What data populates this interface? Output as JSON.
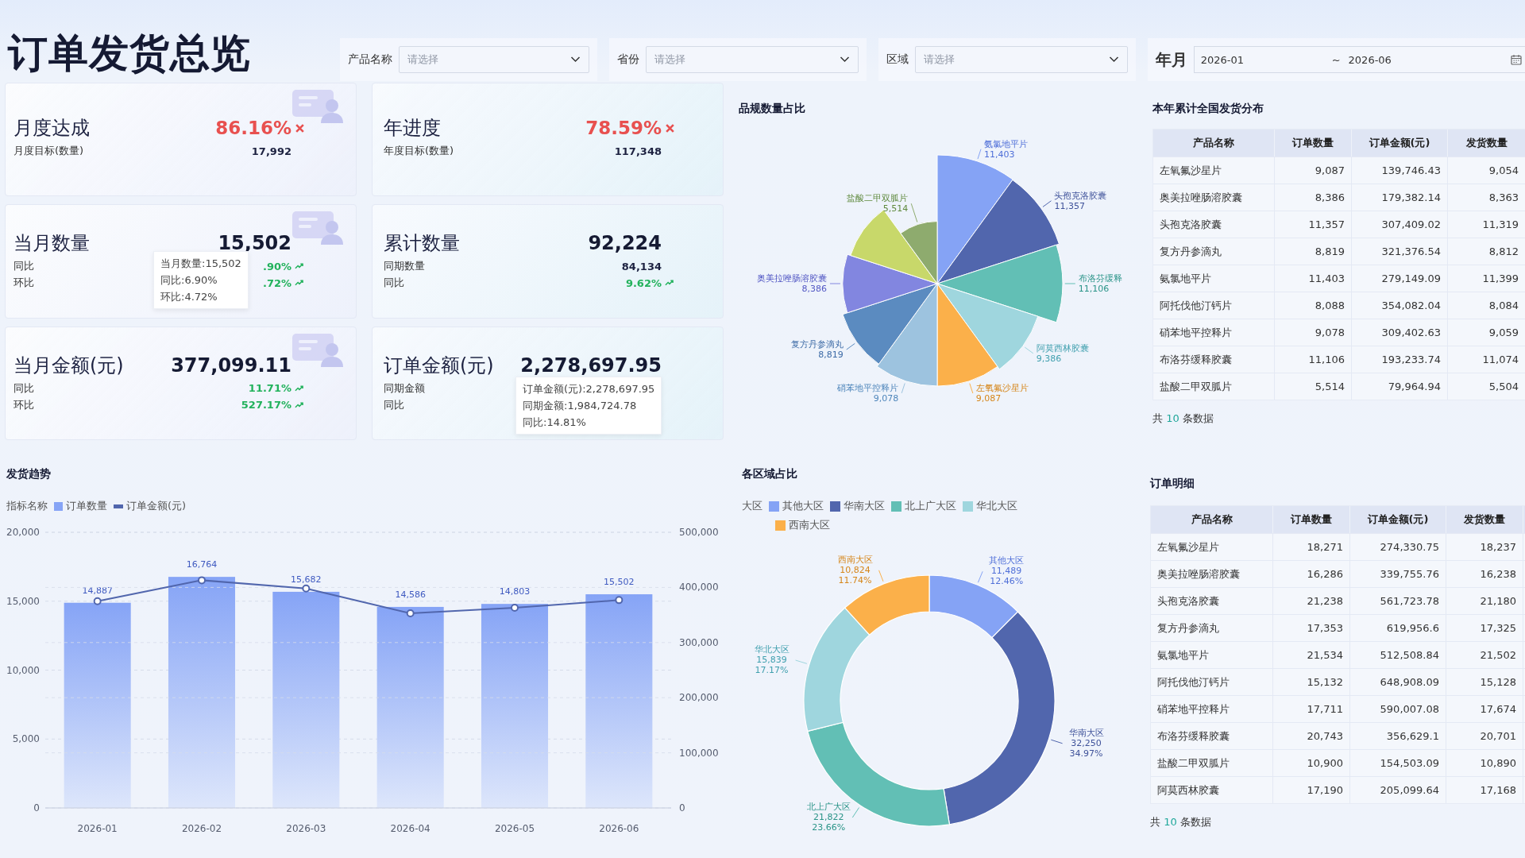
{
  "title": "订单发货总览",
  "filters": [
    {
      "label": "产品名称",
      "placeholder": "请选择"
    },
    {
      "label": "省份",
      "placeholder": "请选择"
    },
    {
      "label": "区域",
      "placeholder": "请选择"
    }
  ],
  "date_filter": {
    "label": "年月",
    "start": "2026-01",
    "separator": "~",
    "end": "2026-06"
  },
  "kpi_cards": [
    {
      "kind": "target",
      "title": "月度达成",
      "value": "86.16%",
      "achieved": false,
      "decor": true,
      "rows": [
        {
          "label": "月度目标(数量)",
          "value": "17,992"
        }
      ]
    },
    {
      "kind": "target",
      "title": "年进度",
      "value": "78.59%",
      "achieved": false,
      "decor": false,
      "rows": [
        {
          "label": "年度目标(数量)",
          "value": "117,348"
        }
      ]
    },
    {
      "kind": "metric",
      "title": "当月数量",
      "value": "15,502",
      "decor": true,
      "rows": [
        {
          "label": "同比",
          "value": ".90%",
          "rising": true
        },
        {
          "label": "环比",
          "value": ".72%",
          "rising": true
        }
      ],
      "tooltip": [
        "当月数量:15,502",
        "同比:6.90%",
        "环比:4.72%"
      ]
    },
    {
      "kind": "metric",
      "title": "累计数量",
      "value": "92,224",
      "decor": false,
      "rows": [
        {
          "label": "同期数量",
          "value": "84,134"
        },
        {
          "label": "同比",
          "value": "9.62%",
          "rising": true
        }
      ]
    },
    {
      "kind": "metric",
      "title": "当月金额(元)",
      "value": "377,099.11",
      "decor": true,
      "rows": [
        {
          "label": "同比",
          "value": "11.71%",
          "rising": true
        },
        {
          "label": "环比",
          "value": "527.17%",
          "rising": true
        }
      ]
    },
    {
      "kind": "metric",
      "title": "订单金额(元)",
      "value": "2,278,697.95",
      "decor": false,
      "rows": [
        {
          "label": "同期金额"
        },
        {
          "label": "同比"
        }
      ],
      "tooltip": [
        "订单金额(元):2,278,697.95",
        "同期金额:1,984,724.78",
        "同比:14.81%"
      ]
    }
  ],
  "pie": {
    "title": "品规数量占比",
    "labels": [
      {
        "name": "氨氯地平片",
        "value": "11,403"
      },
      {
        "name": "盐酸二甲双胍片",
        "value": "5,514"
      },
      {
        "name": "头孢克洛胶囊",
        "value": "11,357"
      },
      {
        "name": "奥美拉唑肠溶胶囊",
        "value": "8,386"
      },
      {
        "name": "布洛芬缓释",
        "value": "11,106"
      },
      {
        "name": "复方丹参滴丸",
        "value": "8,819"
      },
      {
        "name": "阿莫西林胶囊",
        "value": "9,386"
      },
      {
        "name": "硝苯地平控释片",
        "value": "9,078"
      },
      {
        "name": "左氧氟沙星片",
        "value": "9,087"
      }
    ]
  },
  "summary_table": {
    "title": "本年累计全国发货分布",
    "columns": [
      "产品名称",
      "订单数量",
      "订单金额(元)",
      "发货数量"
    ],
    "rows": [
      [
        "左氧氟沙星片",
        "9,087",
        "139,746.43",
        "9,054"
      ],
      [
        "奥美拉唑肠溶胶囊",
        "8,386",
        "179,382.14",
        "8,363"
      ],
      [
        "头孢克洛胶囊",
        "11,357",
        "307,409.02",
        "11,319"
      ],
      [
        "复方丹参滴丸",
        "8,819",
        "321,376.54",
        "8,812"
      ],
      [
        "氨氯地平片",
        "11,403",
        "279,149.09",
        "11,399"
      ],
      [
        "阿托伐他汀钙片",
        "8,088",
        "354,082.04",
        "8,084"
      ],
      [
        "硝苯地平控释片",
        "9,078",
        "309,402.63",
        "9,059"
      ],
      [
        "布洛芬缓释胶囊",
        "11,106",
        "193,233.74",
        "11,074"
      ],
      [
        "盐酸二甲双胍片",
        "5,514",
        "79,964.94",
        "5,504"
      ]
    ],
    "footer": {
      "prefix": "共",
      "count": "10",
      "suffix": "条数据"
    }
  },
  "trend": {
    "title": "发货趋势",
    "legend_title": "指标名称",
    "bars": {
      "chart_data": {
        "type": "bar",
        "categories": [
          "2026-01",
          "2026-02",
          "2026-03",
          "2026-04",
          "2026-05",
          "2026-06"
        ],
        "series": [
          {
            "name": "订单数量",
            "color": "#86a4f6",
            "values": [
              14887,
              16764,
              15682,
              14586,
              14803,
              15502
            ]
          }
        ],
        "ylim": [
          0,
          20000
        ],
        "grid": true,
        "yticks": [
          {
            "value": 0,
            "label": "0"
          },
          {
            "value": 5000,
            "label": "5,000"
          },
          {
            "value": 10000,
            "label": "10,000"
          },
          {
            "value": 15000,
            "label": "15,000"
          },
          {
            "value": 20000,
            "label": "20,000"
          }
        ],
        "value_labels": [
          "14,887",
          "16,764",
          "15,682",
          "14,586",
          "14,803",
          "15,502"
        ]
      }
    },
    "line": {
      "chart_data": {
        "type": "line",
        "series": [
          {
            "name": "订单金额(元)",
            "color": "#5166ad",
            "marker": "circle",
            "values": [
              375000,
              413000,
              398000,
              353000,
              363000,
              377000
            ]
          }
        ],
        "ylim": [
          0,
          500000
        ],
        "grid": true,
        "yticks": [
          {
            "value": 0,
            "label": "0"
          },
          {
            "value": 100000,
            "label": "100,000"
          },
          {
            "value": 200000,
            "label": "200,000"
          },
          {
            "value": 300000,
            "label": "300,000"
          },
          {
            "value": 400000,
            "label": "400,000"
          },
          {
            "value": 500000,
            "label": "500,000"
          }
        ]
      }
    }
  },
  "donut": {
    "title": "各区域占比",
    "legend_title": "大区",
    "chart_data": {
      "type": "donut",
      "categories": [
        "其他大区",
        "华南大区",
        "北上广大区",
        "华北大区",
        "西南大区"
      ],
      "values": [
        11489,
        32250,
        21822,
        15839,
        10824
      ],
      "value_labels": [
        "11,489",
        "32,250",
        "21,822",
        "15,839",
        "10,824"
      ]
    },
    "slice_labels": [
      {
        "name": "其他大区",
        "percent": "12.46%"
      },
      {
        "name": "华南大区",
        "percent": "34.97%"
      },
      {
        "name": "北上广大区",
        "percent": "23.66%"
      },
      {
        "name": "华北大区",
        "percent": "17.17%"
      },
      {
        "name": "西南大区",
        "percent": "11.74%"
      }
    ]
  },
  "detail_table": {
    "title": "订单明细",
    "columns": [
      "产品名称",
      "订单数量",
      "订单金额(元)",
      "发货数量"
    ],
    "rows": [
      [
        "左氧氟沙星片",
        "18,271",
        "274,330.75",
        "18,237"
      ],
      [
        "奥美拉唑肠溶胶囊",
        "16,286",
        "339,755.76",
        "16,238"
      ],
      [
        "头孢克洛胶囊",
        "21,238",
        "561,723.78",
        "21,180"
      ],
      [
        "复方丹参滴丸",
        "17,353",
        "619,956.6",
        "17,325"
      ],
      [
        "氨氯地平片",
        "21,534",
        "512,508.84",
        "21,502"
      ],
      [
        "阿托伐他汀钙片",
        "15,132",
        "648,908.09",
        "15,128"
      ],
      [
        "硝苯地平控释片",
        "17,711",
        "590,007.08",
        "17,674"
      ],
      [
        "布洛芬缓释胶囊",
        "20,743",
        "356,629.1",
        "20,701"
      ],
      [
        "盐酸二甲双胍片",
        "10,900",
        "154,503.09",
        "10,890"
      ],
      [
        "阿莫西林胶囊",
        "17,190",
        "205,099.64",
        "17,168"
      ]
    ],
    "footer": {
      "prefix": "共",
      "count": "10",
      "suffix": "条数据"
    }
  }
}
